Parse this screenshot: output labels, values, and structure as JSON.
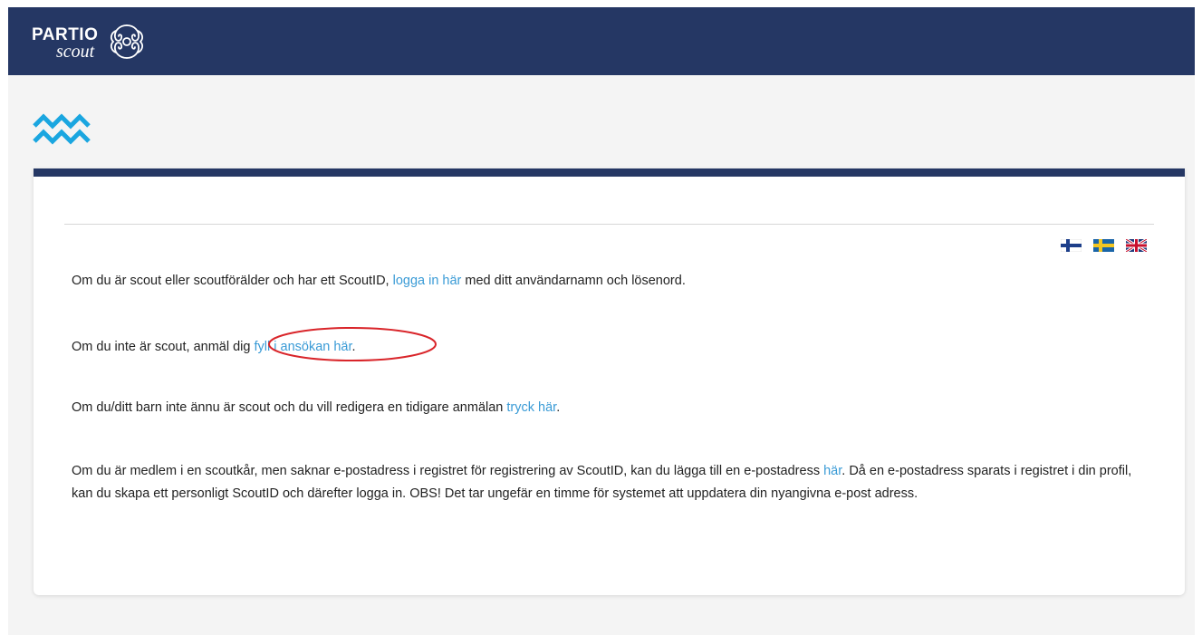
{
  "header": {
    "logo_line1": "PARTIO",
    "logo_line2": "scout"
  },
  "languages": [
    {
      "code": "fi",
      "name": "Suomi"
    },
    {
      "code": "sv",
      "name": "Svenska"
    },
    {
      "code": "en",
      "name": "English"
    }
  ],
  "content": {
    "p1": {
      "before": "Om du är scout eller scoutförälder och har ett ScoutID, ",
      "link": "logga in här",
      "after": " med ditt användarnamn och lösenord."
    },
    "p2": {
      "before": "Om du inte är scout, anmäl dig ",
      "link": "fyll i ansökan här",
      "after": "."
    },
    "p3": {
      "before": "Om du/ditt barn inte ännu är scout och du vill redigera en tidigare anmälan ",
      "link": "tryck här",
      "after": "."
    },
    "p4": {
      "before": "Om du är medlem i en scoutkår, men saknar e-postadress i registret för registrering av ScoutID, kan du lägga till en e-postadress ",
      "link": "här",
      "after": ". Då en e-postadress sparats i registret i din profil, kan du skapa ett personligt ScoutID och därefter logga in. OBS! Det tar ungefär en timme för systemet att uppdatera din nyangivna e-post adress."
    }
  },
  "colors": {
    "header_bg": "#253764",
    "accent": "#1aa6e0",
    "link": "#3a9bd6",
    "annotation": "#d9252a"
  }
}
